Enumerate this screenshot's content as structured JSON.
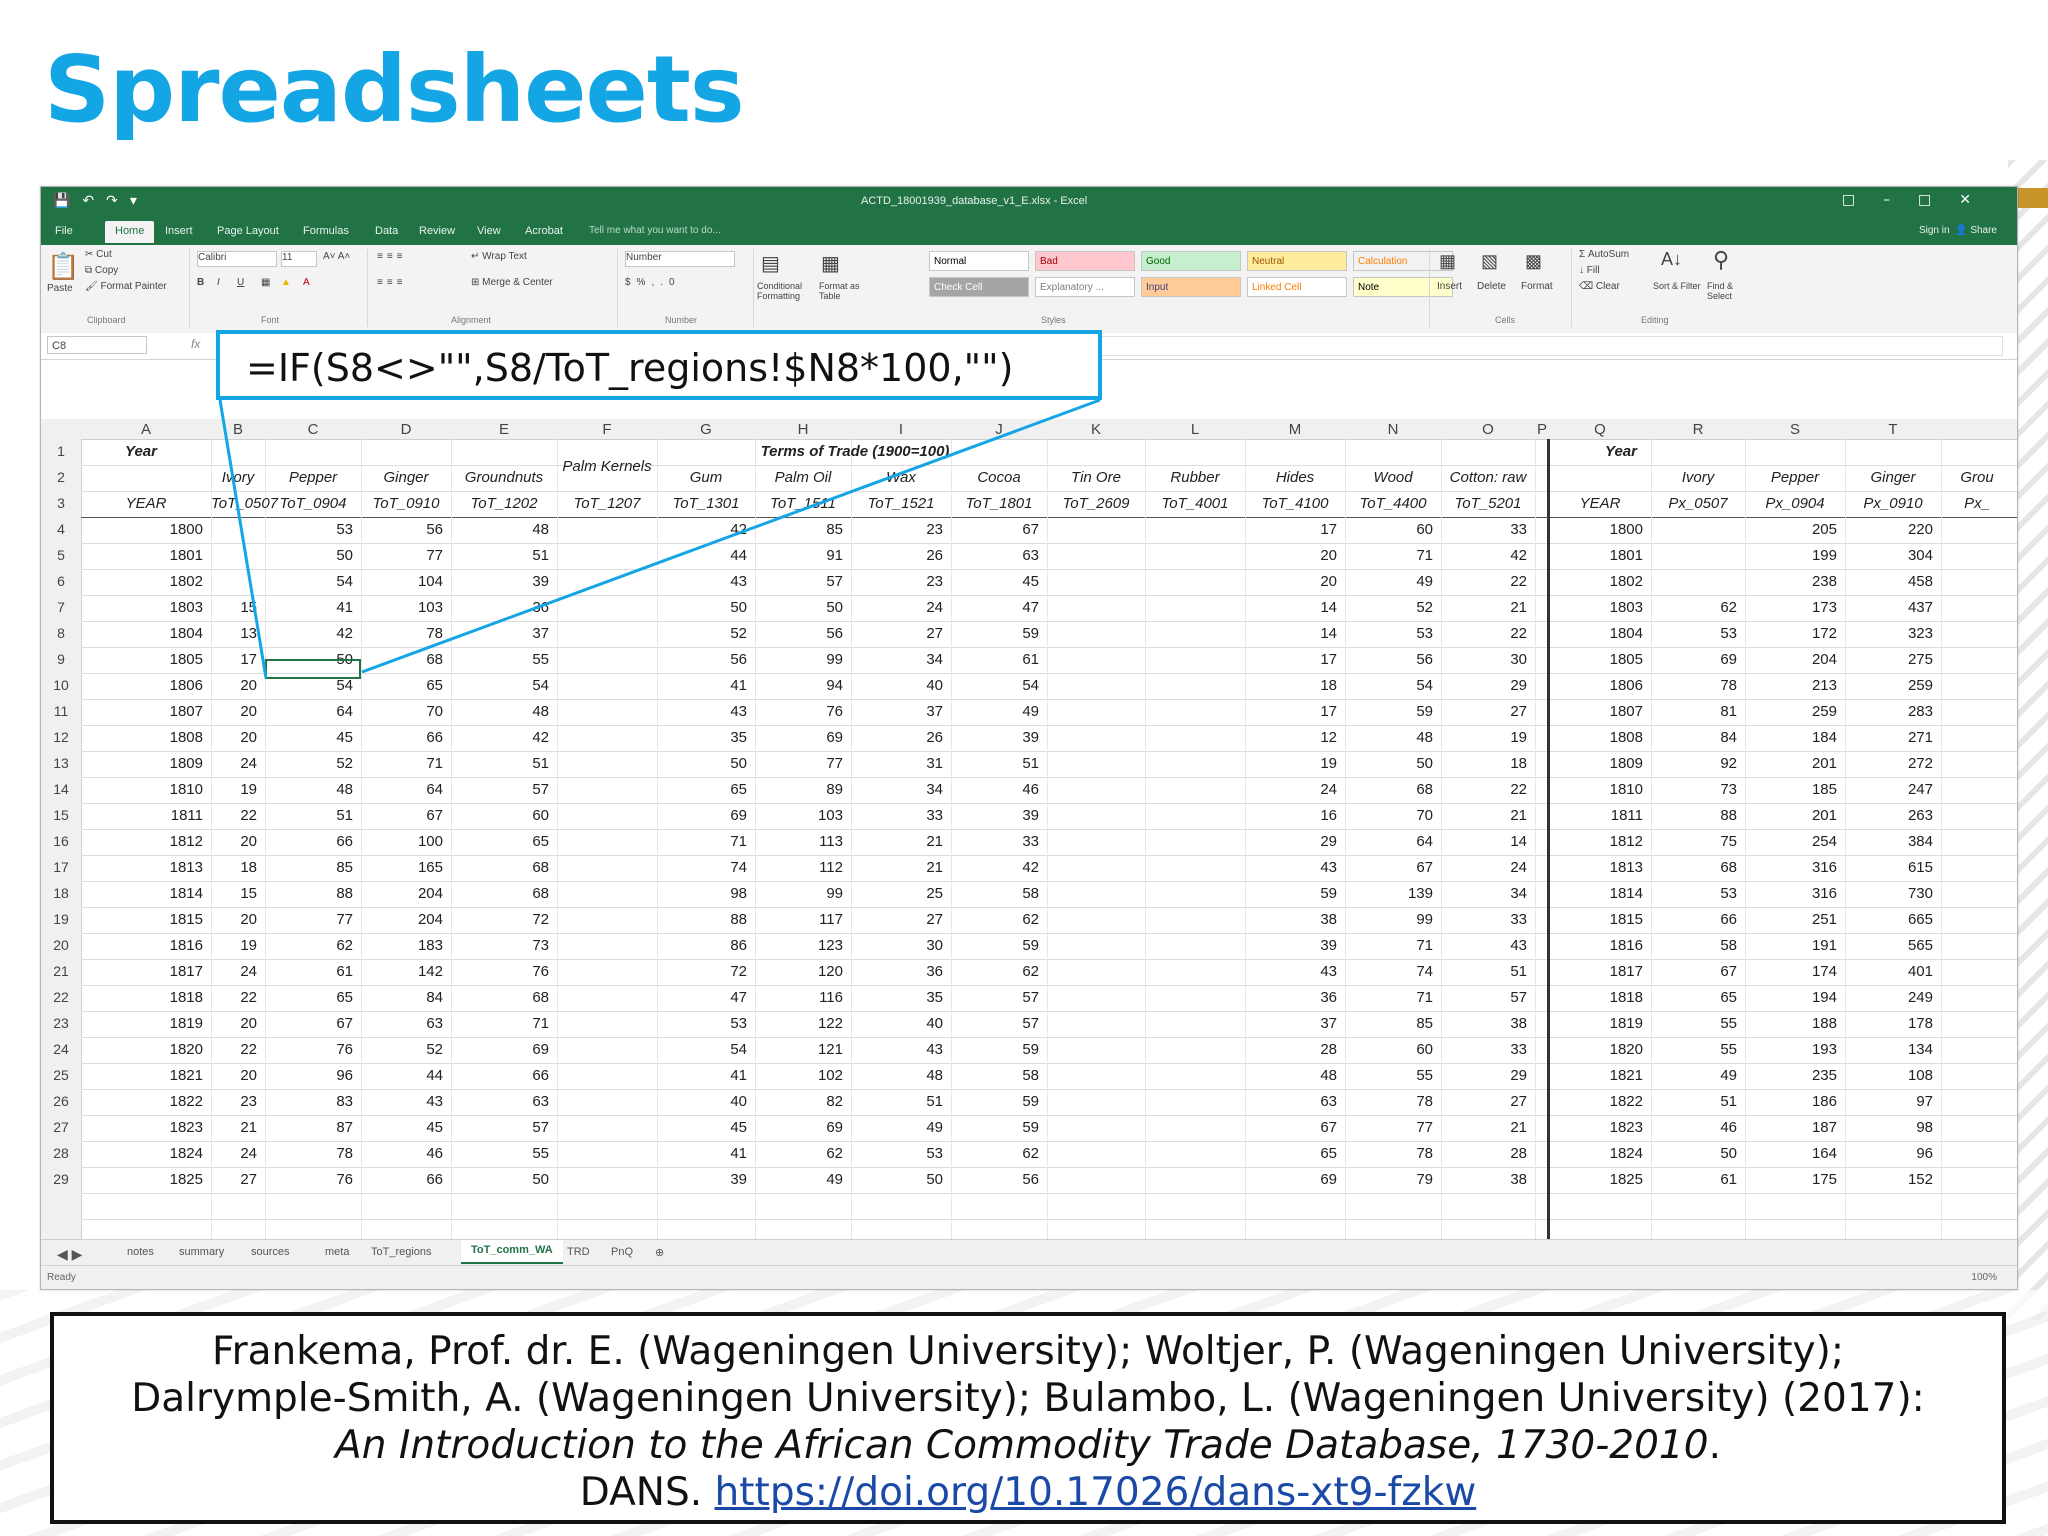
{
  "slide": {
    "title": "Spreadsheets"
  },
  "excel": {
    "window_title": "ACTD_18001939_database_v1_E.xlsx - Excel",
    "ribbon_tabs": [
      "File",
      "Home",
      "Insert",
      "Page Layout",
      "Formulas",
      "Data",
      "Review",
      "View",
      "Acrobat"
    ],
    "tell_me": "Tell me what you want to do...",
    "sign_in": "Sign in",
    "share": "Share",
    "clipboard": {
      "paste": "Paste",
      "cut": "Cut",
      "copy": "Copy",
      "format_painter": "Format Painter",
      "group": "Clipboard"
    },
    "font": {
      "name": "Calibri",
      "size": "11",
      "group": "Font"
    },
    "alignment": {
      "wrap": "Wrap Text",
      "merge": "Merge & Center",
      "group": "Alignment"
    },
    "number": {
      "format": "Number",
      "group": "Number"
    },
    "styles": {
      "conditional": "Conditional Formatting",
      "format_as_table": "Format as Table",
      "cells": [
        {
          "label": "Normal",
          "bg": "#ffffff",
          "fg": "#000000"
        },
        {
          "label": "Bad",
          "bg": "#ffc7ce",
          "fg": "#9c0006"
        },
        {
          "label": "Good",
          "bg": "#c6efce",
          "fg": "#006100"
        },
        {
          "label": "Neutral",
          "bg": "#ffeb9c",
          "fg": "#9c5700"
        },
        {
          "label": "Calculation",
          "bg": "#f2f2f2",
          "fg": "#fa7d00"
        },
        {
          "label": "Check Cell",
          "bg": "#a5a5a5",
          "fg": "#ffffff"
        },
        {
          "label": "Explanatory ...",
          "bg": "#ffffff",
          "fg": "#7f7f7f"
        },
        {
          "label": "Input",
          "bg": "#ffcc99",
          "fg": "#3f3f76"
        },
        {
          "label": "Linked Cell",
          "bg": "#ffffff",
          "fg": "#fa7d00"
        },
        {
          "label": "Note",
          "bg": "#ffffcc",
          "fg": "#000000"
        }
      ],
      "group": "Styles"
    },
    "cells_group": {
      "insert": "Insert",
      "delete": "Delete",
      "format": "Format",
      "group": "Cells"
    },
    "editing": {
      "autosum": "AutoSum",
      "fill": "Fill",
      "clear": "Clear",
      "sort": "Sort & Filter",
      "find": "Find & Select",
      "group": "Editing"
    },
    "name_box": "C8",
    "formula_callout": "=IF(S8<>\"\",S8/ToT_regions!$N8*100,\"\")",
    "column_letters": [
      "A",
      "B",
      "C",
      "D",
      "E",
      "F",
      "G",
      "H",
      "I",
      "J",
      "K",
      "L",
      "M",
      "N",
      "O",
      "P",
      "Q",
      "R",
      "S",
      "T"
    ],
    "row1": {
      "year": "Year",
      "terms": "Terms of Trade (1900=100)",
      "year_q": "Year"
    },
    "row2": [
      "Ivory",
      "Pepper",
      "Ginger",
      "Groundnuts",
      "Palm Kernels",
      "Gum",
      "Palm Oil",
      "Wax",
      "Cocoa",
      "Tin Ore",
      "Rubber",
      "Hides",
      "Wood",
      "Cotton: raw"
    ],
    "row2_right": [
      "Ivory",
      "Pepper",
      "Ginger",
      "Grou"
    ],
    "row3": [
      "YEAR",
      "ToT_0507",
      "ToT_0904",
      "ToT_0910",
      "ToT_1202",
      "ToT_1207",
      "ToT_1301",
      "ToT_1511",
      "ToT_1521",
      "ToT_1801",
      "ToT_2609",
      "ToT_4001",
      "ToT_4100",
      "ToT_4400",
      "ToT_5201"
    ],
    "row3_right": [
      "YEAR",
      "Px_0507",
      "Px_0904",
      "Px_0910",
      "Px_"
    ],
    "rows": [
      {
        "r": "4",
        "a": "1800",
        "b": "",
        "c": "53",
        "d": "56",
        "e": "48",
        "g": "42",
        "h": "85",
        "i": "23",
        "j": "67",
        "m": "17",
        "n": "60",
        "o": "33",
        "q": "1800",
        "rr": "",
        "s": "205",
        "t": "220"
      },
      {
        "r": "5",
        "a": "1801",
        "b": "",
        "c": "50",
        "d": "77",
        "e": "51",
        "g": "44",
        "h": "91",
        "i": "26",
        "j": "63",
        "m": "20",
        "n": "71",
        "o": "42",
        "q": "1801",
        "rr": "",
        "s": "199",
        "t": "304"
      },
      {
        "r": "6",
        "a": "1802",
        "b": "",
        "c": "54",
        "d": "104",
        "e": "39",
        "g": "43",
        "h": "57",
        "i": "23",
        "j": "45",
        "m": "20",
        "n": "49",
        "o": "22",
        "q": "1802",
        "rr": "",
        "s": "238",
        "t": "458"
      },
      {
        "r": "7",
        "a": "1803",
        "b": "15",
        "c": "41",
        "d": "103",
        "e": "36",
        "g": "50",
        "h": "50",
        "i": "24",
        "j": "47",
        "m": "14",
        "n": "52",
        "o": "21",
        "q": "1803",
        "rr": "62",
        "s": "173",
        "t": "437"
      },
      {
        "r": "8",
        "a": "1804",
        "b": "13",
        "c": "42",
        "d": "78",
        "e": "37",
        "g": "52",
        "h": "56",
        "i": "27",
        "j": "59",
        "m": "14",
        "n": "53",
        "o": "22",
        "q": "1804",
        "rr": "53",
        "s": "172",
        "t": "323"
      },
      {
        "r": "9",
        "a": "1805",
        "b": "17",
        "c": "50",
        "d": "68",
        "e": "55",
        "g": "56",
        "h": "99",
        "i": "34",
        "j": "61",
        "m": "17",
        "n": "56",
        "o": "30",
        "q": "1805",
        "rr": "69",
        "s": "204",
        "t": "275"
      },
      {
        "r": "10",
        "a": "1806",
        "b": "20",
        "c": "54",
        "d": "65",
        "e": "54",
        "g": "41",
        "h": "94",
        "i": "40",
        "j": "54",
        "m": "18",
        "n": "54",
        "o": "29",
        "q": "1806",
        "rr": "78",
        "s": "213",
        "t": "259"
      },
      {
        "r": "11",
        "a": "1807",
        "b": "20",
        "c": "64",
        "d": "70",
        "e": "48",
        "g": "43",
        "h": "76",
        "i": "37",
        "j": "49",
        "m": "17",
        "n": "59",
        "o": "27",
        "q": "1807",
        "rr": "81",
        "s": "259",
        "t": "283"
      },
      {
        "r": "12",
        "a": "1808",
        "b": "20",
        "c": "45",
        "d": "66",
        "e": "42",
        "g": "35",
        "h": "69",
        "i": "26",
        "j": "39",
        "m": "12",
        "n": "48",
        "o": "19",
        "q": "1808",
        "rr": "84",
        "s": "184",
        "t": "271"
      },
      {
        "r": "13",
        "a": "1809",
        "b": "24",
        "c": "52",
        "d": "71",
        "e": "51",
        "g": "50",
        "h": "77",
        "i": "31",
        "j": "51",
        "m": "19",
        "n": "50",
        "o": "18",
        "q": "1809",
        "rr": "92",
        "s": "201",
        "t": "272"
      },
      {
        "r": "14",
        "a": "1810",
        "b": "19",
        "c": "48",
        "d": "64",
        "e": "57",
        "g": "65",
        "h": "89",
        "i": "34",
        "j": "46",
        "m": "24",
        "n": "68",
        "o": "22",
        "q": "1810",
        "rr": "73",
        "s": "185",
        "t": "247"
      },
      {
        "r": "15",
        "a": "1811",
        "b": "22",
        "c": "51",
        "d": "67",
        "e": "60",
        "g": "69",
        "h": "103",
        "i": "33",
        "j": "39",
        "m": "16",
        "n": "70",
        "o": "21",
        "q": "1811",
        "rr": "88",
        "s": "201",
        "t": "263"
      },
      {
        "r": "16",
        "a": "1812",
        "b": "20",
        "c": "66",
        "d": "100",
        "e": "65",
        "g": "71",
        "h": "113",
        "i": "21",
        "j": "33",
        "m": "29",
        "n": "64",
        "o": "14",
        "q": "1812",
        "rr": "75",
        "s": "254",
        "t": "384"
      },
      {
        "r": "17",
        "a": "1813",
        "b": "18",
        "c": "85",
        "d": "165",
        "e": "68",
        "g": "74",
        "h": "112",
        "i": "21",
        "j": "42",
        "m": "43",
        "n": "67",
        "o": "24",
        "q": "1813",
        "rr": "68",
        "s": "316",
        "t": "615"
      },
      {
        "r": "18",
        "a": "1814",
        "b": "15",
        "c": "88",
        "d": "204",
        "e": "68",
        "g": "98",
        "h": "99",
        "i": "25",
        "j": "58",
        "m": "59",
        "n": "139",
        "o": "34",
        "q": "1814",
        "rr": "53",
        "s": "316",
        "t": "730"
      },
      {
        "r": "19",
        "a": "1815",
        "b": "20",
        "c": "77",
        "d": "204",
        "e": "72",
        "g": "88",
        "h": "117",
        "i": "27",
        "j": "62",
        "m": "38",
        "n": "99",
        "o": "33",
        "q": "1815",
        "rr": "66",
        "s": "251",
        "t": "665"
      },
      {
        "r": "20",
        "a": "1816",
        "b": "19",
        "c": "62",
        "d": "183",
        "e": "73",
        "g": "86",
        "h": "123",
        "i": "30",
        "j": "59",
        "m": "39",
        "n": "71",
        "o": "43",
        "q": "1816",
        "rr": "58",
        "s": "191",
        "t": "565"
      },
      {
        "r": "21",
        "a": "1817",
        "b": "24",
        "c": "61",
        "d": "142",
        "e": "76",
        "g": "72",
        "h": "120",
        "i": "36",
        "j": "62",
        "m": "43",
        "n": "74",
        "o": "51",
        "q": "1817",
        "rr": "67",
        "s": "174",
        "t": "401"
      },
      {
        "r": "22",
        "a": "1818",
        "b": "22",
        "c": "65",
        "d": "84",
        "e": "68",
        "g": "47",
        "h": "116",
        "i": "35",
        "j": "57",
        "m": "36",
        "n": "71",
        "o": "57",
        "q": "1818",
        "rr": "65",
        "s": "194",
        "t": "249"
      },
      {
        "r": "23",
        "a": "1819",
        "b": "20",
        "c": "67",
        "d": "63",
        "e": "71",
        "g": "53",
        "h": "122",
        "i": "40",
        "j": "57",
        "m": "37",
        "n": "85",
        "o": "38",
        "q": "1819",
        "rr": "55",
        "s": "188",
        "t": "178"
      },
      {
        "r": "24",
        "a": "1820",
        "b": "22",
        "c": "76",
        "d": "52",
        "e": "69",
        "g": "54",
        "h": "121",
        "i": "43",
        "j": "59",
        "m": "28",
        "n": "60",
        "o": "33",
        "q": "1820",
        "rr": "55",
        "s": "193",
        "t": "134"
      },
      {
        "r": "25",
        "a": "1821",
        "b": "20",
        "c": "96",
        "d": "44",
        "e": "66",
        "g": "41",
        "h": "102",
        "i": "48",
        "j": "58",
        "m": "48",
        "n": "55",
        "o": "29",
        "q": "1821",
        "rr": "49",
        "s": "235",
        "t": "108"
      },
      {
        "r": "26",
        "a": "1822",
        "b": "23",
        "c": "83",
        "d": "43",
        "e": "63",
        "g": "40",
        "h": "82",
        "i": "51",
        "j": "59",
        "m": "63",
        "n": "78",
        "o": "27",
        "q": "1822",
        "rr": "51",
        "s": "186",
        "t": "97"
      },
      {
        "r": "27",
        "a": "1823",
        "b": "21",
        "c": "87",
        "d": "45",
        "e": "57",
        "g": "45",
        "h": "69",
        "i": "49",
        "j": "59",
        "m": "67",
        "n": "77",
        "o": "21",
        "q": "1823",
        "rr": "46",
        "s": "187",
        "t": "98"
      },
      {
        "r": "28",
        "a": "1824",
        "b": "24",
        "c": "78",
        "d": "46",
        "e": "55",
        "g": "41",
        "h": "62",
        "i": "53",
        "j": "62",
        "m": "65",
        "n": "78",
        "o": "28",
        "q": "1824",
        "rr": "50",
        "s": "164",
        "t": "96"
      },
      {
        "r": "29",
        "a": "1825",
        "b": "27",
        "c": "76",
        "d": "66",
        "e": "50",
        "g": "39",
        "h": "49",
        "i": "50",
        "j": "56",
        "m": "69",
        "n": "79",
        "o": "38",
        "q": "1825",
        "rr": "61",
        "s": "175",
        "t": "152"
      }
    ],
    "sheet_tabs": [
      "notes",
      "summary",
      "sources",
      "meta",
      "ToT_regions",
      "ToT_comm_WA",
      "TRD",
      "PnQ"
    ],
    "active_sheet": "ToT_comm_WA",
    "status": "Ready",
    "zoom": "100%"
  },
  "citation": {
    "line1": "Frankema, Prof. dr. E. (Wageningen University); Woltjer, P. (Wageningen University);",
    "line2": "Dalrymple-Smith, A. (Wageningen University); Bulambo, L. (Wageningen University) (2017):",
    "line3": "An Introduction to the African Commodity Trade Database, 1730-2010",
    "line3_end": ".",
    "line4_prefix": "DANS.",
    "link": "https://doi.org/10.17026/dans-xt9-fzkw"
  },
  "colors": {
    "title": "#14a5e4",
    "excel_green": "#217346",
    "callout": "#14a5e4",
    "link": "#1a4aa6"
  }
}
